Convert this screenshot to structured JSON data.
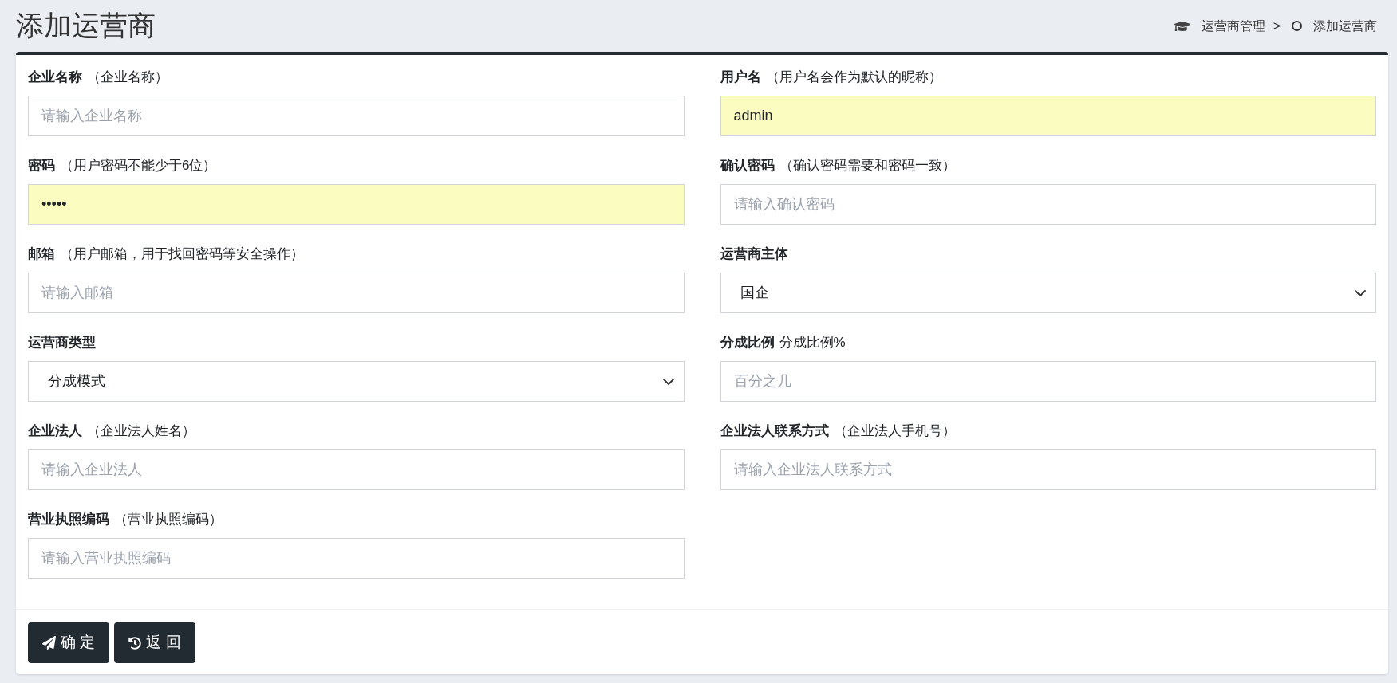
{
  "page_title": "添加运营商",
  "breadcrumb": {
    "parent": "运营商管理",
    "separator": ">",
    "current": "添加运营商"
  },
  "fields": [
    {
      "label": "企业名称",
      "hint": "（企业名称）",
      "kind": "input",
      "placeholder": "请输入企业名称",
      "autofilled": false
    },
    {
      "label": "用户名",
      "hint": "（用户名会作为默认的昵称）",
      "kind": "input",
      "value": "admin",
      "autofilled": true
    },
    {
      "label": "密码",
      "hint": "（用户密码不能少于6位）",
      "kind": "input",
      "value": "•••••",
      "autofilled": true
    },
    {
      "label": "确认密码",
      "hint": "（确认密码需要和密码一致）",
      "kind": "input",
      "placeholder": "请输入确认密码",
      "autofilled": false
    },
    {
      "label": "邮箱",
      "hint": "（用户邮箱，用于找回密码等安全操作）",
      "kind": "input",
      "placeholder": "请输入邮箱",
      "autofilled": false
    },
    {
      "label": "运营商主体",
      "kind": "select",
      "value": "国企",
      "autofilled": false
    },
    {
      "label": "运营商类型",
      "kind": "select",
      "value": "分成模式",
      "autofilled": false
    },
    {
      "label": "分成比例",
      "hint": "分成比例%",
      "kind": "input",
      "placeholder": "百分之几",
      "autofilled": false
    },
    {
      "label": "企业法人",
      "hint": "（企业法人姓名）",
      "kind": "input",
      "placeholder": "请输入企业法人",
      "autofilled": false
    },
    {
      "label": "企业法人联系方式",
      "hint": "（企业法人手机号）",
      "kind": "input",
      "placeholder": "请输入企业法人联系方式",
      "autofilled": false
    },
    {
      "label": "营业执照编码",
      "hint": "（营业执照编码）",
      "kind": "input",
      "placeholder": "请输入营业执照编码",
      "autofilled": false
    }
  ],
  "buttons": [
    {
      "label": "确 定",
      "kind": "submit"
    },
    {
      "label": "返 回",
      "kind": "back"
    }
  ]
}
